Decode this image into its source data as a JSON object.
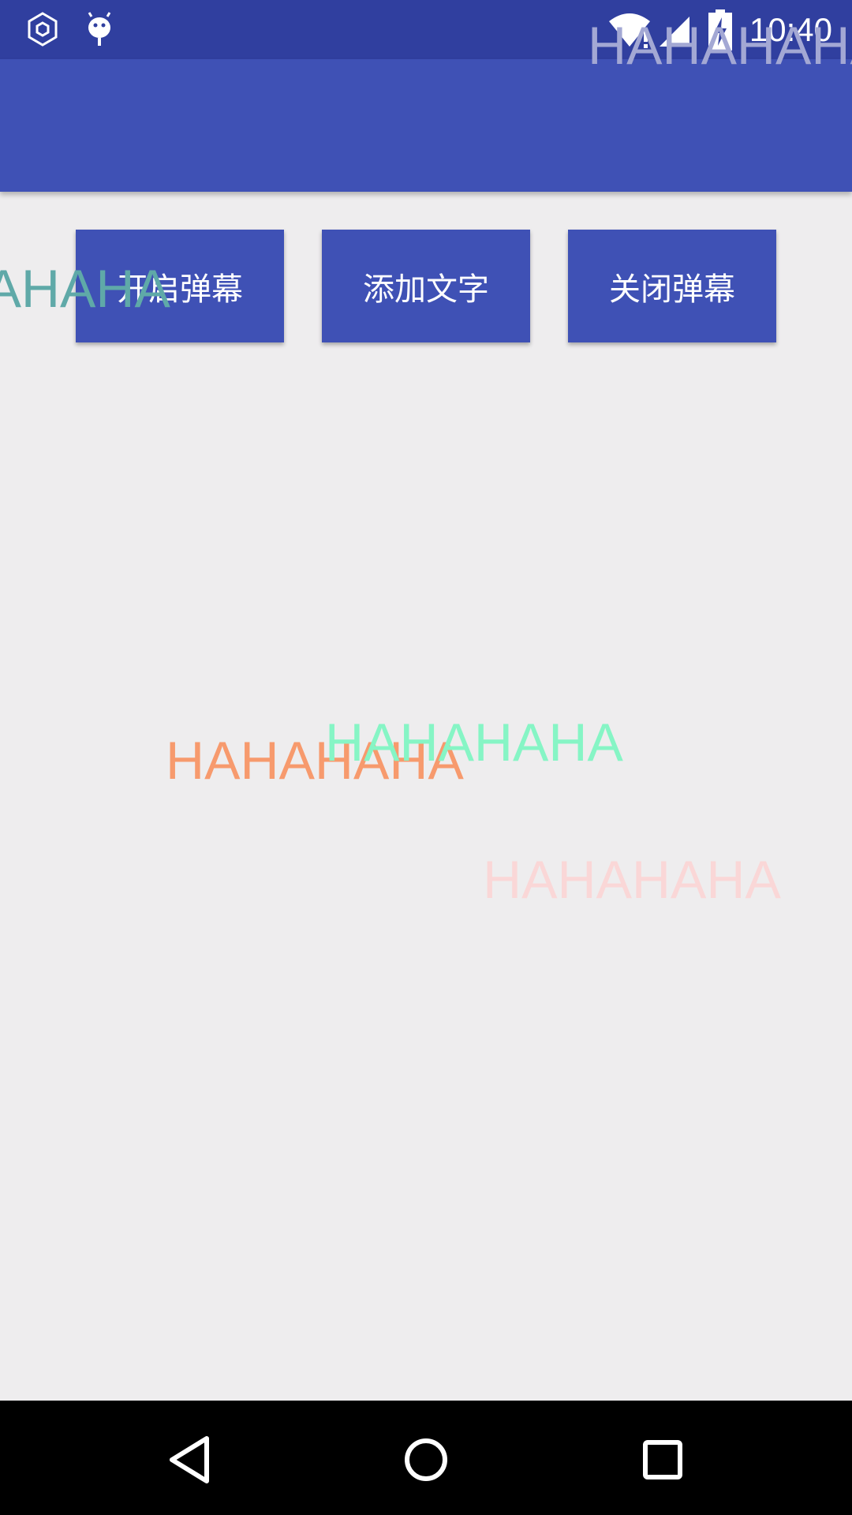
{
  "status_bar": {
    "time": "10:40",
    "icons": [
      "settings-hexagon-icon",
      "android-debug-icon",
      "wifi-icon",
      "cell-signal-icon",
      "battery-charging-icon"
    ]
  },
  "toolbar": {
    "buttons": [
      {
        "label": "开启弹幕"
      },
      {
        "label": "添加文字"
      },
      {
        "label": "关闭弹幕"
      }
    ]
  },
  "danmaku": [
    {
      "text": "HAHAHAHA",
      "color": "#a3a8d4"
    },
    {
      "text": "HAHAHAHA",
      "color": "#5fa9a8"
    },
    {
      "text": "HAHAHAHA",
      "color": "#f79a6d"
    },
    {
      "text": "HAHAHAHA",
      "color": "#86f5c5"
    },
    {
      "text": "HAHAHAHA",
      "color": "#fad7d7"
    }
  ],
  "nav_bar": {
    "icons": [
      "back-icon",
      "home-icon",
      "recents-icon"
    ]
  },
  "colors": {
    "primary": "#3f51b5",
    "primary_dark": "#303f9f",
    "background": "#eeedee"
  }
}
